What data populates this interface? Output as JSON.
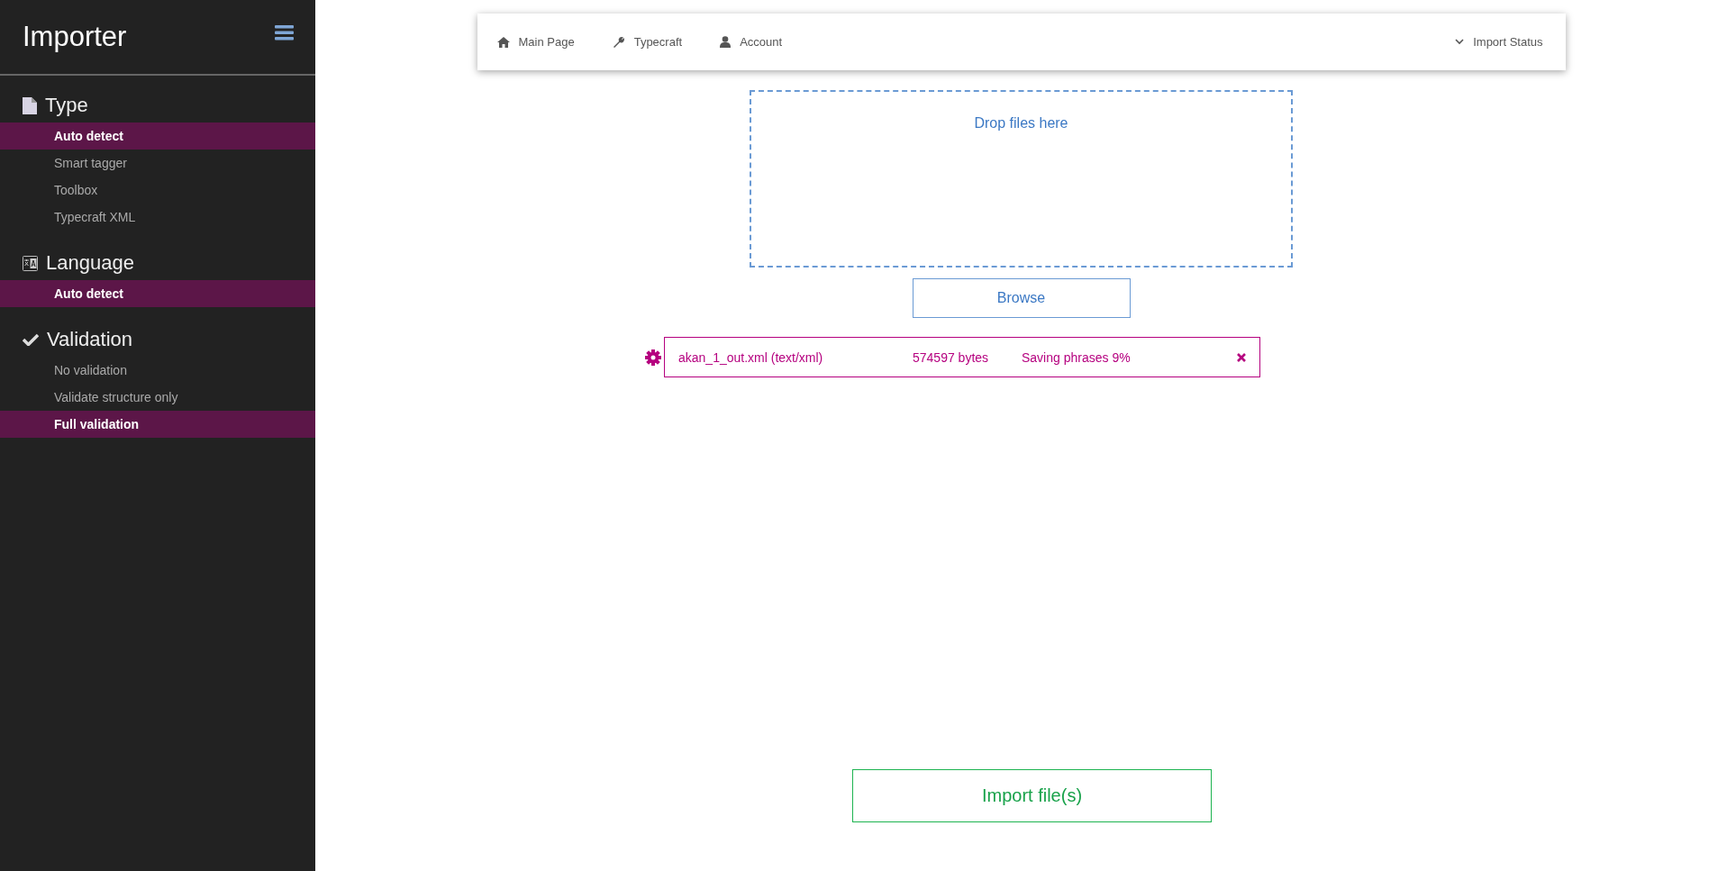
{
  "sidebar": {
    "title": "Importer",
    "sections": [
      {
        "title": "Type",
        "items": [
          {
            "label": "Auto detect",
            "selected": true
          },
          {
            "label": "Smart tagger",
            "selected": false
          },
          {
            "label": "Toolbox",
            "selected": false
          },
          {
            "label": "Typecraft XML",
            "selected": false
          }
        ]
      },
      {
        "title": "Language",
        "items": [
          {
            "label": "Auto detect",
            "selected": true
          }
        ]
      },
      {
        "title": "Validation",
        "items": [
          {
            "label": "No validation",
            "selected": false
          },
          {
            "label": "Validate structure only",
            "selected": false
          },
          {
            "label": "Full validation",
            "selected": true
          }
        ]
      }
    ]
  },
  "navbar": {
    "left": [
      {
        "label": "Main Page"
      },
      {
        "label": "Typecraft"
      },
      {
        "label": "Account"
      }
    ],
    "right": {
      "label": "Import Status"
    }
  },
  "dropzone": {
    "text": "Drop files here"
  },
  "browse_button": "Browse",
  "uploads": [
    {
      "file": "akan_1_out.xml (text/xml)",
      "size": "574597 bytes",
      "status": "Saving phrases 9%"
    }
  ],
  "import_button": "Import file(s)"
}
